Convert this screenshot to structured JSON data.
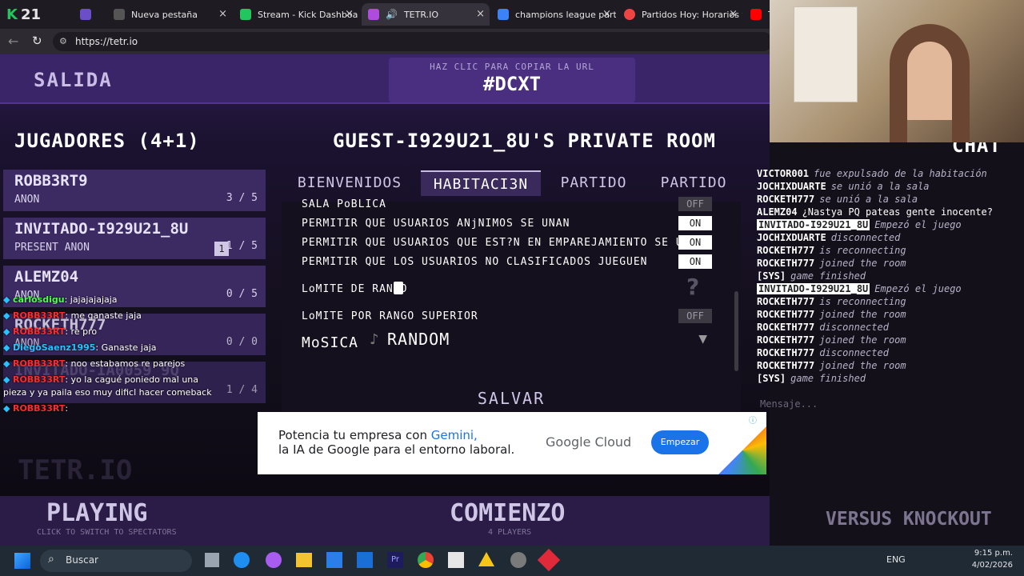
{
  "browser": {
    "tabs": [
      {
        "label": "21",
        "fav": "#22c55e"
      },
      {
        "label": "",
        "fav": "#6b4fc8"
      },
      {
        "label": "Nueva pestaña",
        "fav": "#555"
      },
      {
        "label": "Stream - Kick Dashboard",
        "fav": "#22c55e"
      },
      {
        "label": "TETR.IO",
        "fav": "#b04be0"
      },
      {
        "label": "champions league parti",
        "fav": "#3b82f6"
      },
      {
        "label": "Partidos Hoy: Horarios y",
        "fav": "#ef4444"
      },
      {
        "label": "T",
        "fav": "#ff0000"
      }
    ],
    "url": "https://tetr.io"
  },
  "game": {
    "exit_label": "SALIDA",
    "room_hint": "HAZ CLIC PARA COPIAR LA URL",
    "room_code": "#DCXT",
    "players_header": "JUGADORES (4+1)",
    "room_title": "GUEST-I929U21_8U'S PRIVATE ROOM",
    "players": [
      {
        "name": "ROBB3RT9",
        "tag": "ANON",
        "count": "3 / 5"
      },
      {
        "name": "INVITADO-I929U21_8U",
        "tag": "PRESENT ANON",
        "badge": "1",
        "count": "1 / 5"
      },
      {
        "name": "ALEMZ04",
        "tag": "ANON",
        "count": "0 / 5"
      },
      {
        "name": "ROCKETH777",
        "tag": "ANON",
        "count": "0 / 0"
      },
      {
        "name": "INVITADO-IA0059_9Q",
        "tag": "",
        "count": "1 / 4"
      }
    ],
    "tabs": [
      "BIENVENIDOS",
      "HABITACI3N",
      "PARTIDO",
      "PARTIDO"
    ],
    "options": [
      {
        "label": "SALA PoBLICA",
        "toggle": "OFF"
      },
      {
        "label": "PERMITIR QUE USUARIOS ANjNIMOS SE UNAN",
        "toggle": "ON"
      },
      {
        "label": "PERMITIR QUE USUARIOS QUE EST?N EN EMPAREJAMIENTO SE UNAN",
        "toggle": "ON"
      },
      {
        "label": "PERMITIR QUE LOS USUARIOS NO CLASIFICADOS JUEGUEN",
        "toggle": "ON"
      },
      {
        "label": "LoMITE DE RANGO",
        "toggle": "?"
      },
      {
        "label": "LoMITE POR RANGO SUPERIOR",
        "toggle": "OFF"
      }
    ],
    "music_label": "MoSICA",
    "music_value": "RANDOM",
    "save_label": "SALVAR",
    "chat_title": "CHAT",
    "chat": [
      {
        "name": "VICTOR001",
        "msg": "fue expulsado de la habitación"
      },
      {
        "name": "JOCHIXDUARTE",
        "msg": "se unió a la sala"
      },
      {
        "name": "ROCKETH777",
        "msg": "se unió a la sala"
      },
      {
        "name": "ALEMZ04",
        "msg": "¿Nastya PQ pateas gente inocente?",
        "plain": true
      },
      {
        "name": "INVITADO-I929U21_8U",
        "msg": "Empezó el juego",
        "hl": true
      },
      {
        "name": "JOCHIXDUARTE",
        "msg": "disconnected"
      },
      {
        "name": "ROCKETH777",
        "msg": "is reconnecting"
      },
      {
        "name": "ROCKETH777",
        "msg": "joined the room"
      },
      {
        "name": "[SYS]",
        "msg": "game finished"
      },
      {
        "name": "INVITADO-I929U21_8U",
        "msg": "Empezó el juego",
        "hl": true
      },
      {
        "name": "ROCKETH777",
        "msg": "is reconnecting"
      },
      {
        "name": "ROCKETH777",
        "msg": "joined the room"
      },
      {
        "name": "ROCKETH777",
        "msg": "disconnected"
      },
      {
        "name": "ROCKETH777",
        "msg": "joined the room"
      },
      {
        "name": "ROCKETH777",
        "msg": "disconnected"
      },
      {
        "name": "ROCKETH777",
        "msg": "joined the room"
      },
      {
        "name": "[SYS]",
        "msg": "game finished"
      }
    ],
    "chat_placeholder": "Mensaje...",
    "playing_label": "PLAYING",
    "playing_sub": "CLICK TO SWITCH TO SPECTATORS",
    "start_label": "COMIENZO",
    "start_sub": "4 PLAYERS",
    "mode_label": "VERSUS KNOCKOUT",
    "logo": "TETR.IO"
  },
  "stream_chat": [
    {
      "user": "carlosdigu",
      "msg": ": jajajajajaja",
      "c": "ugr"
    },
    {
      "user": "ROBB33RT",
      "msg": ": me ganaste jaja",
      "c": "u"
    },
    {
      "user": "ROBB33RT",
      "msg": ": re pro",
      "c": "u"
    },
    {
      "user": "DiegoSaenz1995",
      "msg": ": Ganaste jaja",
      "c": "ug"
    },
    {
      "user": "ROBB33RT",
      "msg": ": noo estabamos re parejos",
      "c": "u"
    },
    {
      "user": "ROBB33RT",
      "msg": ": yo la cagué poniedo mal una",
      "c": "u"
    },
    {
      "user": "",
      "msg": "pieza y ya paila eso muy dificl hacer comeback",
      "c": "u"
    },
    {
      "user": "ROBB33RT",
      "msg": ":",
      "c": "u"
    }
  ],
  "ad": {
    "line1a": "Potencia tu empresa con ",
    "line1b": "Gemini,",
    "line2": "la IA de Google para el entorno laboral.",
    "brand": "Google Cloud",
    "cta": "Empezar"
  },
  "taskbar": {
    "search": "Buscar",
    "lang": "ENG",
    "time": "9:15 p.m.",
    "date": "4/02/2026"
  }
}
